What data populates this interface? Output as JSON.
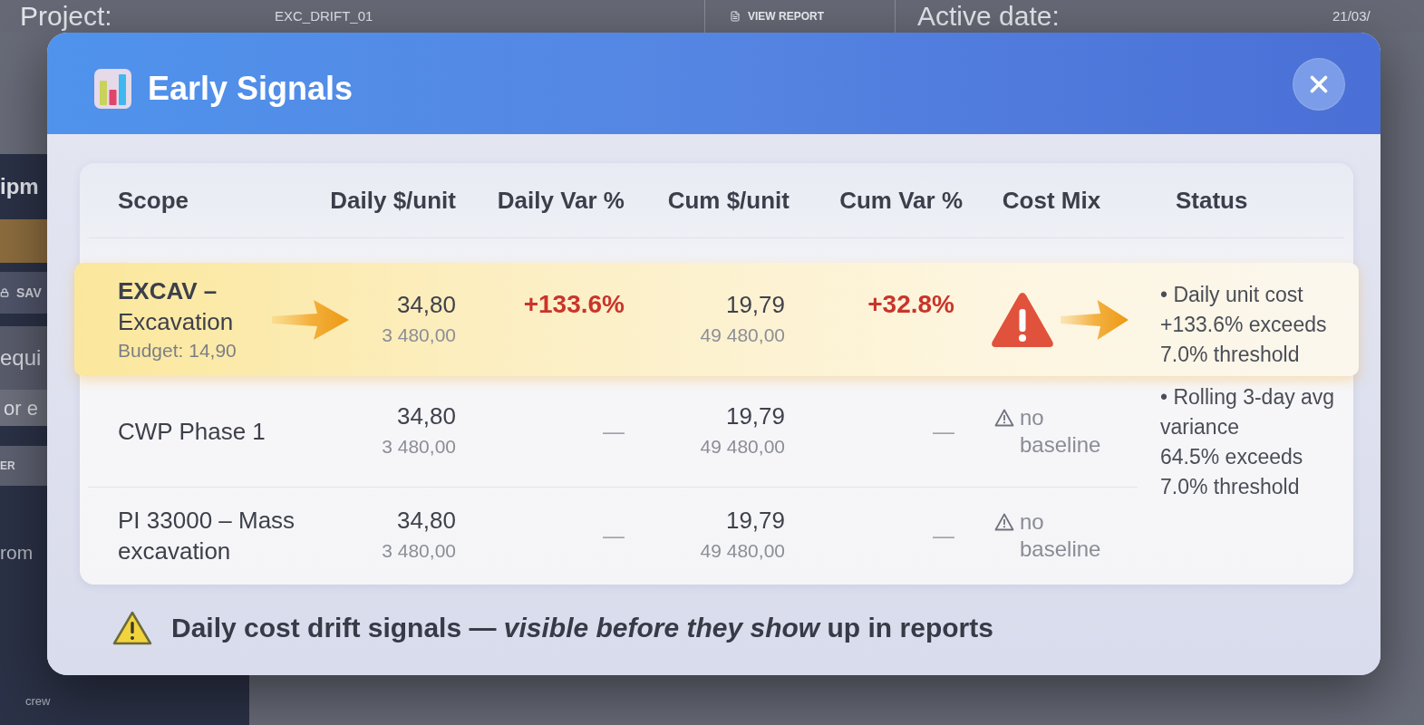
{
  "background": {
    "top_bar": [
      {
        "kind": "heading",
        "text": "Project:"
      },
      {
        "kind": "field",
        "text": "EXC_DRIFT_01"
      },
      {
        "kind": "link",
        "text": "VIEW REPORT"
      },
      {
        "kind": "heading",
        "text": "Active date:"
      },
      {
        "kind": "field",
        "text": "21/03/"
      }
    ],
    "sidebar": [
      {
        "kind": "heading",
        "text": "ipm"
      },
      {
        "kind": "accent"
      },
      {
        "kind": "icon_button",
        "text": "SAV"
      },
      {
        "kind": "label",
        "text": "equi"
      },
      {
        "kind": "field",
        "text": "or e"
      },
      {
        "kind": "button",
        "text": "ER"
      },
      {
        "kind": "text",
        "text": "rom"
      },
      {
        "kind": "footnote",
        "text": "crew"
      }
    ]
  },
  "dialog": {
    "title": "Early Signals",
    "columns": [
      "Scope",
      "Daily $/unit",
      "Daily Var %",
      "Cum $/unit",
      "Cum Var %",
      "Cost Mix",
      "Status"
    ],
    "rows": [
      {
        "highlighted": true,
        "scope": "**EXCAV –**\nExcavation",
        "budget": "Budget: 14,90",
        "daily_unit": "34,80",
        "daily_total": "3 480,00",
        "daily_var": {
          "text": "+133.6%",
          "alert": true
        },
        "cum_unit": "19,79",
        "cum_total": "49 480,00",
        "cum_var": {
          "text": "+32.8%",
          "alert": true
        },
        "cost_mix": {
          "kind": "alert"
        }
      },
      {
        "highlighted": false,
        "scope": "CWP Phase 1",
        "daily_unit": "34,80",
        "daily_total": "3 480,00",
        "daily_var": {
          "text": "—",
          "alert": false
        },
        "cum_unit": "19,79",
        "cum_total": "49 480,00",
        "cum_var": {
          "text": "—",
          "alert": false
        },
        "cost_mix": {
          "kind": "no_baseline",
          "text": "no baseline"
        }
      },
      {
        "highlighted": false,
        "scope": "PI 33000 – Mass\nexcavation",
        "daily_unit": "34,80",
        "daily_total": "3 480,00",
        "daily_var": {
          "text": "—",
          "alert": false
        },
        "cum_unit": "19,79",
        "cum_total": "49 480,00",
        "cum_var": {
          "text": "—",
          "alert": false
        },
        "cost_mix": {
          "kind": "no_baseline",
          "text": "no baseline"
        }
      }
    ],
    "status_notes": [
      "• Daily unit cost\n+133.6% exceeds\n7.0% threshold",
      "• Rolling 3-day avg\nvariance\n64.5% exceeds\n7.0% threshold"
    ],
    "footer": "Daily cost drift signals — *visible before they show* up in reports"
  }
}
